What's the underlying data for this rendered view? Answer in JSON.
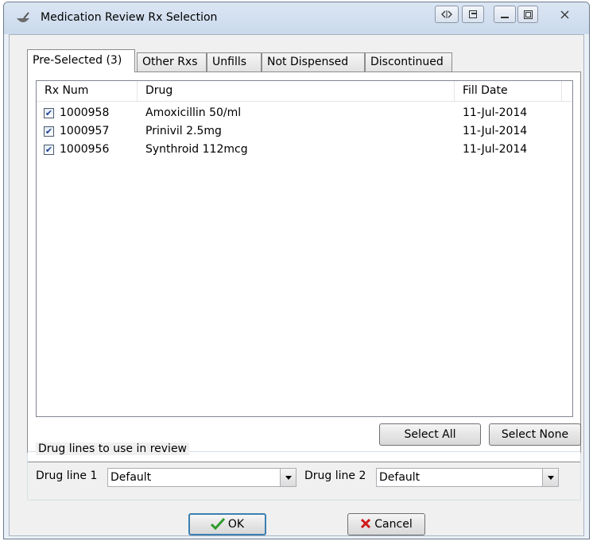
{
  "window": {
    "title": "Medication Review Rx Selection"
  },
  "tabs": [
    {
      "label": "Pre-Selected (3)"
    },
    {
      "label": "Other Rxs"
    },
    {
      "label": "Unfills"
    },
    {
      "label": "Not Dispensed"
    },
    {
      "label": "Discontinued"
    }
  ],
  "table": {
    "columns": [
      "Rx Num",
      "Drug",
      "Fill Date"
    ],
    "rows": [
      {
        "rx": "1000958",
        "drug": "Amoxicillin  50/ml",
        "date": "11-Jul-2014",
        "checked": true
      },
      {
        "rx": "1000957",
        "drug": "Prinivil 2.5mg",
        "date": "11-Jul-2014",
        "checked": true
      },
      {
        "rx": "1000956",
        "drug": "Synthroid 112mcg",
        "date": "11-Jul-2014",
        "checked": true
      }
    ]
  },
  "buttons": {
    "select_all": "Select All",
    "select_none": "Select None",
    "ok": "OK",
    "cancel": "Cancel"
  },
  "drug_lines": {
    "group_title": "Drug lines to use in review",
    "line1_label": "Drug line 1",
    "line1_value": "Default",
    "line2_label": "Drug line 2",
    "line2_value": "Default"
  },
  "colors": {
    "ok_check": "#2e9b2e",
    "cancel_x": "#d01818",
    "checkbox_mark": "#1c3f94"
  },
  "icons": {
    "app": "mortar-pestle-icon",
    "ok": "checkmark-icon",
    "cancel": "x-icon"
  }
}
